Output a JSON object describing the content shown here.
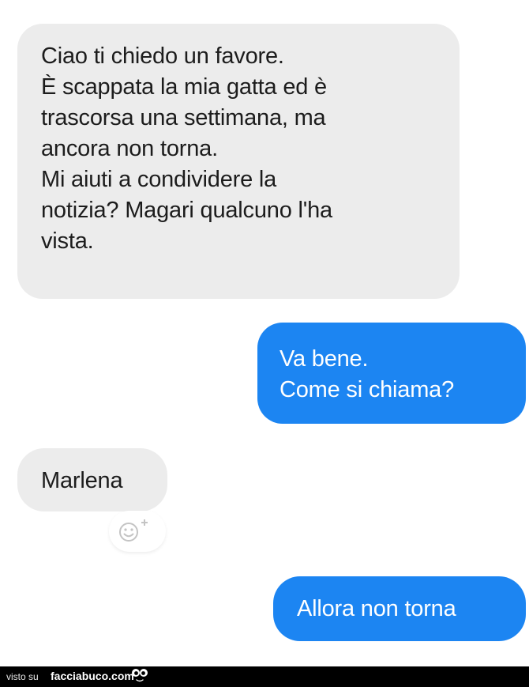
{
  "conversation": {
    "messages": [
      {
        "sender": "incoming",
        "lines": [
          "Ciao ti chiedo un favore.",
          "È scappata la mia gatta ed è",
          "trascorsa una settimana, ma",
          "ancora non torna.",
          "Mi aiuti a condividere la",
          "notizia? Magari qualcuno l'ha",
          "vista."
        ]
      },
      {
        "sender": "outgoing",
        "lines": [
          "Va bene.",
          "Come si chiama?"
        ]
      },
      {
        "sender": "incoming",
        "lines": [
          "Marlena"
        ]
      },
      {
        "sender": "outgoing",
        "lines": [
          "Allora non torna"
        ]
      }
    ],
    "reaction_icon": "add-reaction-smiley-icon"
  },
  "colors": {
    "incoming_bubble": "#ececec",
    "outgoing_bubble": "#1c85f2",
    "incoming_text": "#1c1c1c",
    "outgoing_text": "#ffffff"
  },
  "footer": {
    "prefix": "visto su",
    "site": "facciabuco.com",
    "logo_icon": "facciabuco-eyes-logo"
  }
}
